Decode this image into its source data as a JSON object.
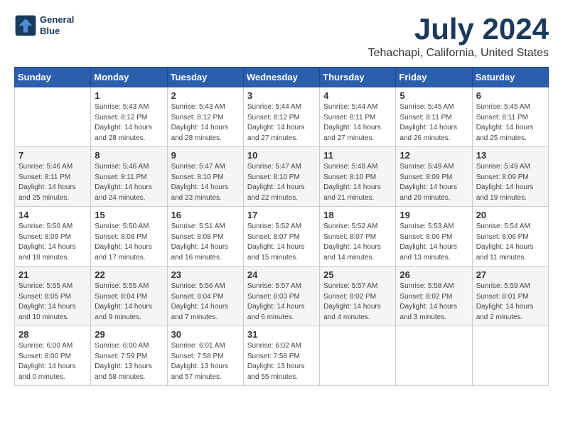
{
  "header": {
    "logo_line1": "General",
    "logo_line2": "Blue",
    "title": "July 2024",
    "subtitle": "Tehachapi, California, United States"
  },
  "calendar": {
    "days_of_week": [
      "Sunday",
      "Monday",
      "Tuesday",
      "Wednesday",
      "Thursday",
      "Friday",
      "Saturday"
    ],
    "weeks": [
      [
        {
          "day": "",
          "info": ""
        },
        {
          "day": "1",
          "info": "Sunrise: 5:43 AM\nSunset: 8:12 PM\nDaylight: 14 hours\nand 28 minutes."
        },
        {
          "day": "2",
          "info": "Sunrise: 5:43 AM\nSunset: 8:12 PM\nDaylight: 14 hours\nand 28 minutes."
        },
        {
          "day": "3",
          "info": "Sunrise: 5:44 AM\nSunset: 8:12 PM\nDaylight: 14 hours\nand 27 minutes."
        },
        {
          "day": "4",
          "info": "Sunrise: 5:44 AM\nSunset: 8:11 PM\nDaylight: 14 hours\nand 27 minutes."
        },
        {
          "day": "5",
          "info": "Sunrise: 5:45 AM\nSunset: 8:11 PM\nDaylight: 14 hours\nand 26 minutes."
        },
        {
          "day": "6",
          "info": "Sunrise: 5:45 AM\nSunset: 8:11 PM\nDaylight: 14 hours\nand 25 minutes."
        }
      ],
      [
        {
          "day": "7",
          "info": "Sunrise: 5:46 AM\nSunset: 8:11 PM\nDaylight: 14 hours\nand 25 minutes."
        },
        {
          "day": "8",
          "info": "Sunrise: 5:46 AM\nSunset: 8:11 PM\nDaylight: 14 hours\nand 24 minutes."
        },
        {
          "day": "9",
          "info": "Sunrise: 5:47 AM\nSunset: 8:10 PM\nDaylight: 14 hours\nand 23 minutes."
        },
        {
          "day": "10",
          "info": "Sunrise: 5:47 AM\nSunset: 8:10 PM\nDaylight: 14 hours\nand 22 minutes."
        },
        {
          "day": "11",
          "info": "Sunrise: 5:48 AM\nSunset: 8:10 PM\nDaylight: 14 hours\nand 21 minutes."
        },
        {
          "day": "12",
          "info": "Sunrise: 5:49 AM\nSunset: 8:09 PM\nDaylight: 14 hours\nand 20 minutes."
        },
        {
          "day": "13",
          "info": "Sunrise: 5:49 AM\nSunset: 8:09 PM\nDaylight: 14 hours\nand 19 minutes."
        }
      ],
      [
        {
          "day": "14",
          "info": "Sunrise: 5:50 AM\nSunset: 8:09 PM\nDaylight: 14 hours\nand 18 minutes."
        },
        {
          "day": "15",
          "info": "Sunrise: 5:50 AM\nSunset: 8:08 PM\nDaylight: 14 hours\nand 17 minutes."
        },
        {
          "day": "16",
          "info": "Sunrise: 5:51 AM\nSunset: 8:08 PM\nDaylight: 14 hours\nand 16 minutes."
        },
        {
          "day": "17",
          "info": "Sunrise: 5:52 AM\nSunset: 8:07 PM\nDaylight: 14 hours\nand 15 minutes."
        },
        {
          "day": "18",
          "info": "Sunrise: 5:52 AM\nSunset: 8:07 PM\nDaylight: 14 hours\nand 14 minutes."
        },
        {
          "day": "19",
          "info": "Sunrise: 5:53 AM\nSunset: 8:06 PM\nDaylight: 14 hours\nand 13 minutes."
        },
        {
          "day": "20",
          "info": "Sunrise: 5:54 AM\nSunset: 8:06 PM\nDaylight: 14 hours\nand 11 minutes."
        }
      ],
      [
        {
          "day": "21",
          "info": "Sunrise: 5:55 AM\nSunset: 8:05 PM\nDaylight: 14 hours\nand 10 minutes."
        },
        {
          "day": "22",
          "info": "Sunrise: 5:55 AM\nSunset: 8:04 PM\nDaylight: 14 hours\nand 9 minutes."
        },
        {
          "day": "23",
          "info": "Sunrise: 5:56 AM\nSunset: 8:04 PM\nDaylight: 14 hours\nand 7 minutes."
        },
        {
          "day": "24",
          "info": "Sunrise: 5:57 AM\nSunset: 8:03 PM\nDaylight: 14 hours\nand 6 minutes."
        },
        {
          "day": "25",
          "info": "Sunrise: 5:57 AM\nSunset: 8:02 PM\nDaylight: 14 hours\nand 4 minutes."
        },
        {
          "day": "26",
          "info": "Sunrise: 5:58 AM\nSunset: 8:02 PM\nDaylight: 14 hours\nand 3 minutes."
        },
        {
          "day": "27",
          "info": "Sunrise: 5:59 AM\nSunset: 8:01 PM\nDaylight: 14 hours\nand 2 minutes."
        }
      ],
      [
        {
          "day": "28",
          "info": "Sunrise: 6:00 AM\nSunset: 8:00 PM\nDaylight: 14 hours\nand 0 minutes."
        },
        {
          "day": "29",
          "info": "Sunrise: 6:00 AM\nSunset: 7:59 PM\nDaylight: 13 hours\nand 58 minutes."
        },
        {
          "day": "30",
          "info": "Sunrise: 6:01 AM\nSunset: 7:58 PM\nDaylight: 13 hours\nand 57 minutes."
        },
        {
          "day": "31",
          "info": "Sunrise: 6:02 AM\nSunset: 7:58 PM\nDaylight: 13 hours\nand 55 minutes."
        },
        {
          "day": "",
          "info": ""
        },
        {
          "day": "",
          "info": ""
        },
        {
          "day": "",
          "info": ""
        }
      ]
    ]
  }
}
